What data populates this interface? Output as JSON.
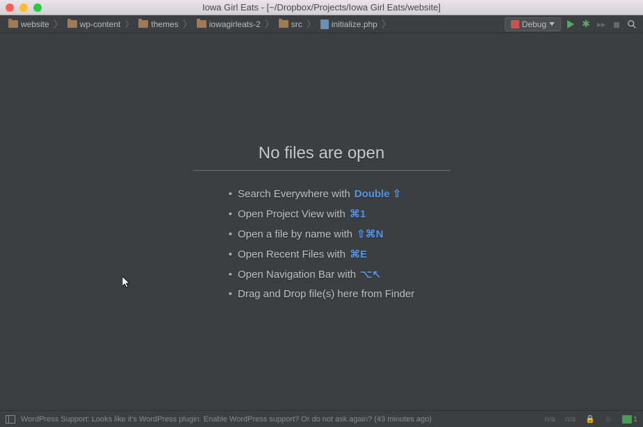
{
  "window": {
    "title": "Iowa Girl Eats - [~/Dropbox/Projects/Iowa Girl Eats/website]"
  },
  "breadcrumbs": [
    {
      "label": "website",
      "type": "folder"
    },
    {
      "label": "wp-content",
      "type": "folder"
    },
    {
      "label": "themes",
      "type": "folder"
    },
    {
      "label": "iowagirleats-2",
      "type": "folder"
    },
    {
      "label": "src",
      "type": "folder"
    },
    {
      "label": "initialize.php",
      "type": "file"
    }
  ],
  "toolbar": {
    "debug_label": "Debug"
  },
  "empty": {
    "heading": "No files are open",
    "hints": [
      {
        "text": "Search Everywhere with",
        "shortcut": "Double ⇧"
      },
      {
        "text": "Open Project View with",
        "shortcut": "⌘1"
      },
      {
        "text": "Open a file by name with",
        "shortcut": "⇧⌘N"
      },
      {
        "text": "Open Recent Files with",
        "shortcut": "⌘E"
      },
      {
        "text": "Open Navigation Bar with",
        "shortcut": "⌥↖"
      },
      {
        "text": "Drag and Drop file(s) here from Finder",
        "shortcut": ""
      }
    ]
  },
  "statusbar": {
    "message": "WordPress Support: Looks like it's WordPress plugin. Enable WordPress support? Or do not ask again? (43 minutes ago)",
    "na1": "n/a",
    "na2": "n/a",
    "badge_count": "1"
  }
}
